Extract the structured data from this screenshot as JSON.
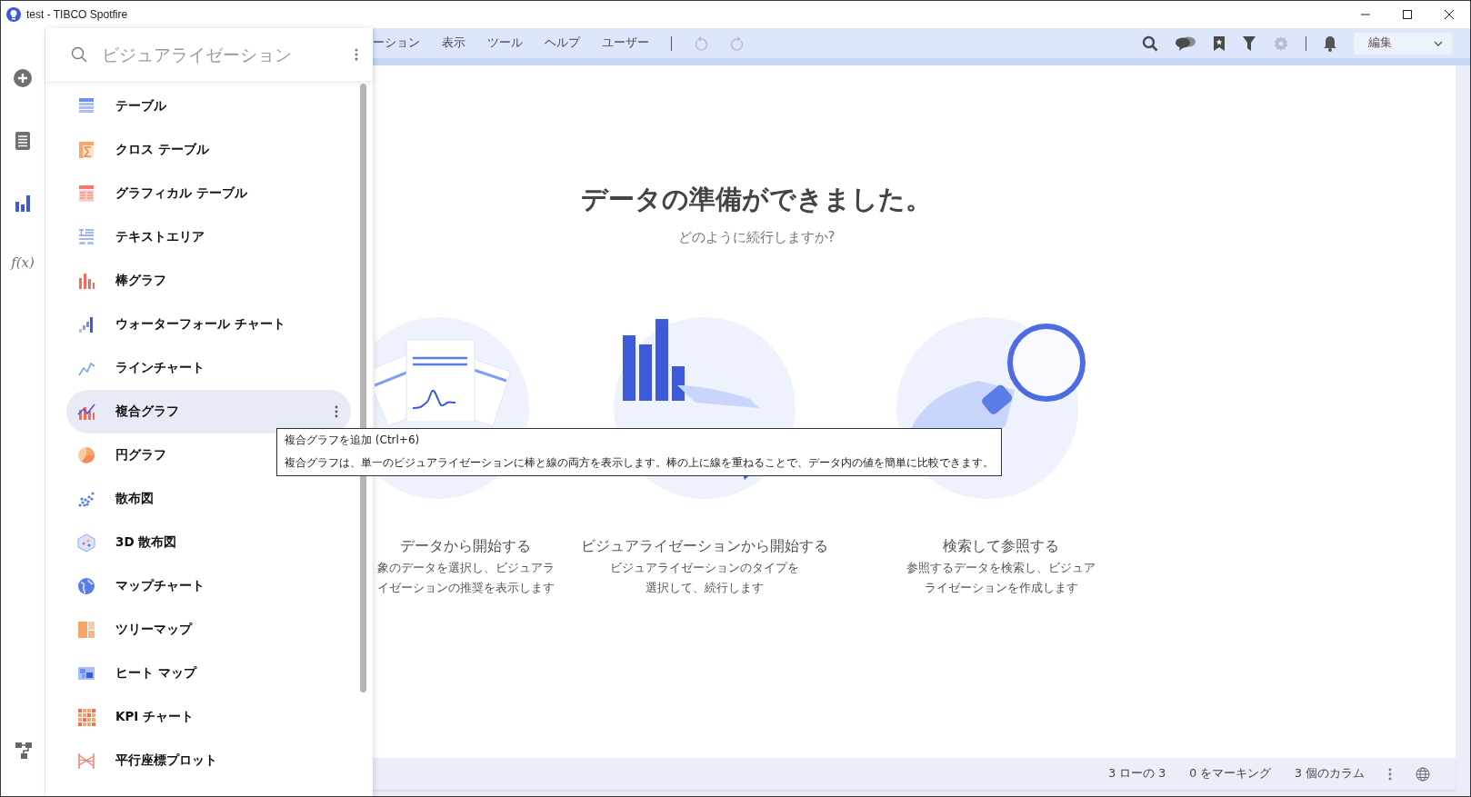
{
  "window": {
    "title": "test - TIBCO Spotfire"
  },
  "rail": [
    {
      "kind": "add",
      "selected": false
    },
    {
      "kind": "data",
      "selected": false
    },
    {
      "kind": "visualizations",
      "selected": true
    },
    {
      "kind": "expression",
      "label": "f(x)",
      "selected": false
    }
  ],
  "panel": {
    "search": {
      "placeholder": "ビジュアライゼーション"
    },
    "items": [
      {
        "kind": "table",
        "label": "テーブル",
        "selected": false
      },
      {
        "kind": "crosstable",
        "label": "クロス テーブル",
        "selected": false
      },
      {
        "kind": "graphical",
        "label": "グラフィカル テーブル",
        "selected": false
      },
      {
        "kind": "text",
        "label": "テキストエリア",
        "selected": false
      },
      {
        "kind": "bar",
        "label": "棒グラフ",
        "selected": false
      },
      {
        "kind": "waterfall",
        "label": "ウォーターフォール チャート",
        "selected": false
      },
      {
        "kind": "line",
        "label": "ラインチャート",
        "selected": false
      },
      {
        "kind": "combo",
        "label": "複合グラフ",
        "selected": true
      },
      {
        "kind": "pie",
        "label": "円グラフ",
        "selected": false
      },
      {
        "kind": "scatter",
        "label": "散布図",
        "selected": false
      },
      {
        "kind": "scatter3d",
        "label": "3D 散布図",
        "selected": false
      },
      {
        "kind": "map",
        "label": "マップチャート",
        "selected": false
      },
      {
        "kind": "treemap",
        "label": "ツリーマップ",
        "selected": false
      },
      {
        "kind": "heatmap",
        "label": "ヒート マップ",
        "selected": false
      },
      {
        "kind": "kpi",
        "label": "KPI チャート",
        "selected": false
      },
      {
        "kind": "parallel",
        "label": "平行座標プロット",
        "selected": false
      }
    ]
  },
  "tooltip": {
    "title": "複合グラフを追加 (Ctrl+6)",
    "text": "複合グラフは、単一のビジュアライゼーションに棒と線の両方を表示します。棒の上に線を重ねることで、データ内の値を簡単に比較できます。"
  },
  "menu": [
    "ーション",
    "表示",
    "ツール",
    "ヘルプ",
    "ユーザー"
  ],
  "history": [
    {
      "kind": "undo",
      "disabled": true
    },
    {
      "kind": "redo",
      "disabled": true
    }
  ],
  "tools": [
    {
      "kind": "search",
      "disabled": false
    },
    {
      "kind": "comments",
      "disabled": false
    },
    {
      "kind": "bookmark",
      "disabled": false
    },
    {
      "kind": "filter",
      "disabled": false
    },
    {
      "kind": "settings",
      "disabled": true
    }
  ],
  "mode": {
    "value": "編集"
  },
  "hero": {
    "title": "データの準備ができました。",
    "subtitle": "どのように続行しますか?"
  },
  "options": [
    {
      "kind": "data",
      "title": "データから開始する",
      "lines": [
        "象のデータを選択し、ビジュアラ",
        "イゼーションの推奨を表示します"
      ]
    },
    {
      "kind": "visualization",
      "title": "ビジュアライゼーションから開始する",
      "lines": [
        "ビジュアライゼーションのタイプを",
        "選択して、続行します"
      ]
    },
    {
      "kind": "search",
      "title": "検索して参照する",
      "lines": [
        "参照するデータを検索し、ビジュア",
        "ライゼーションを作成します"
      ]
    }
  ],
  "status": [
    "3 ローの 3",
    "0 をマーキング",
    "3 個のカラム"
  ]
}
